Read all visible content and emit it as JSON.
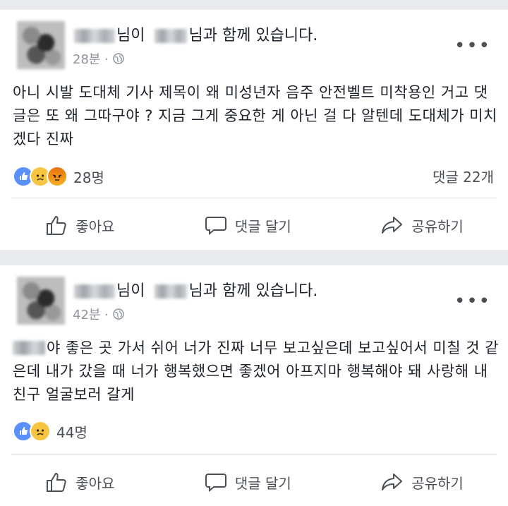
{
  "posts": [
    {
      "header_suffix_1": "님이",
      "header_suffix_2": "님과 함께 있습니다.",
      "time": "28분 ·",
      "text": "아니 시발 도대체 기사 제목이 왜 미성년자 음주 안전벨트 미착용인 거고 댓글은 또 왜 그따구야 ? 지금 그게 중요한 게 아닌 걸 다 알텐데 도대체가 미치겠다 진짜",
      "reactions": [
        "like",
        "sad",
        "angry"
      ],
      "reaction_count": "28명",
      "comments": "댓글 22개"
    },
    {
      "header_suffix_1": "님이",
      "header_suffix_2": "님과 함께 있습니다.",
      "time": "42분 ·",
      "text": "야 좋은 곳 가서 쉬어 너가 진짜 너무 보고싶은데 보고싶어서 미칠 것 같은데 내가 갔을 때 너가 행복했으면 좋겠어 아프지마 행복해야 돼 사랑해 내 친구 얼굴보러 갈게",
      "reactions": [
        "like",
        "sad"
      ],
      "reaction_count": "44명",
      "comments": ""
    }
  ],
  "actions": {
    "like": "좋아요",
    "comment": "댓글 달기",
    "share": "공유하기"
  },
  "icons": {
    "more": "more-horizontal-icon",
    "privacy": "globe-icon",
    "like": "thumbs-up-icon",
    "comment": "speech-bubble-icon",
    "share": "share-arrow-icon"
  },
  "colors": {
    "like_blue": "#5890ff",
    "sad_yellow": "#f7c542",
    "angry_orange": "#e9710f",
    "muted_text": "#90949c"
  }
}
